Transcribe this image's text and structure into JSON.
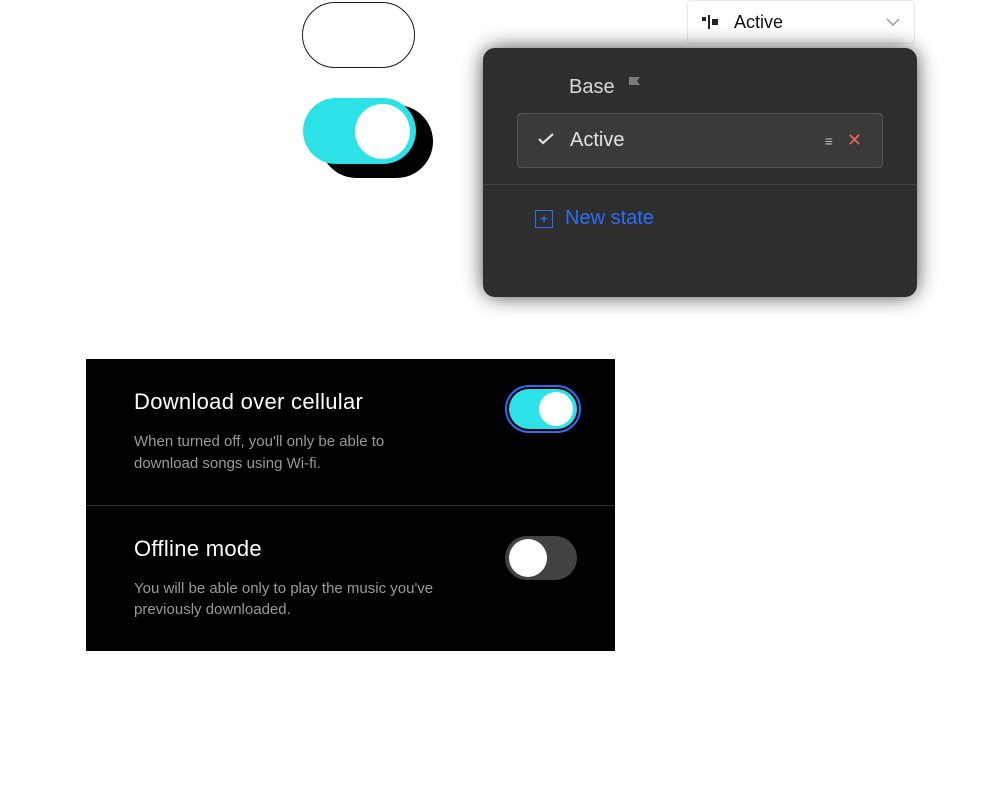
{
  "dropdown": {
    "label": "Active"
  },
  "panel": {
    "base_label": "Base",
    "state_label": "Active",
    "new_state_label": "New state"
  },
  "settings": [
    {
      "title": "Download over cellular",
      "desc": "When turned off, you'll only be able to download songs using Wi-fi.",
      "on": true
    },
    {
      "title": "Offline mode",
      "desc": "You will be able only to play the music you've previously downloaded.",
      "on": false
    }
  ]
}
